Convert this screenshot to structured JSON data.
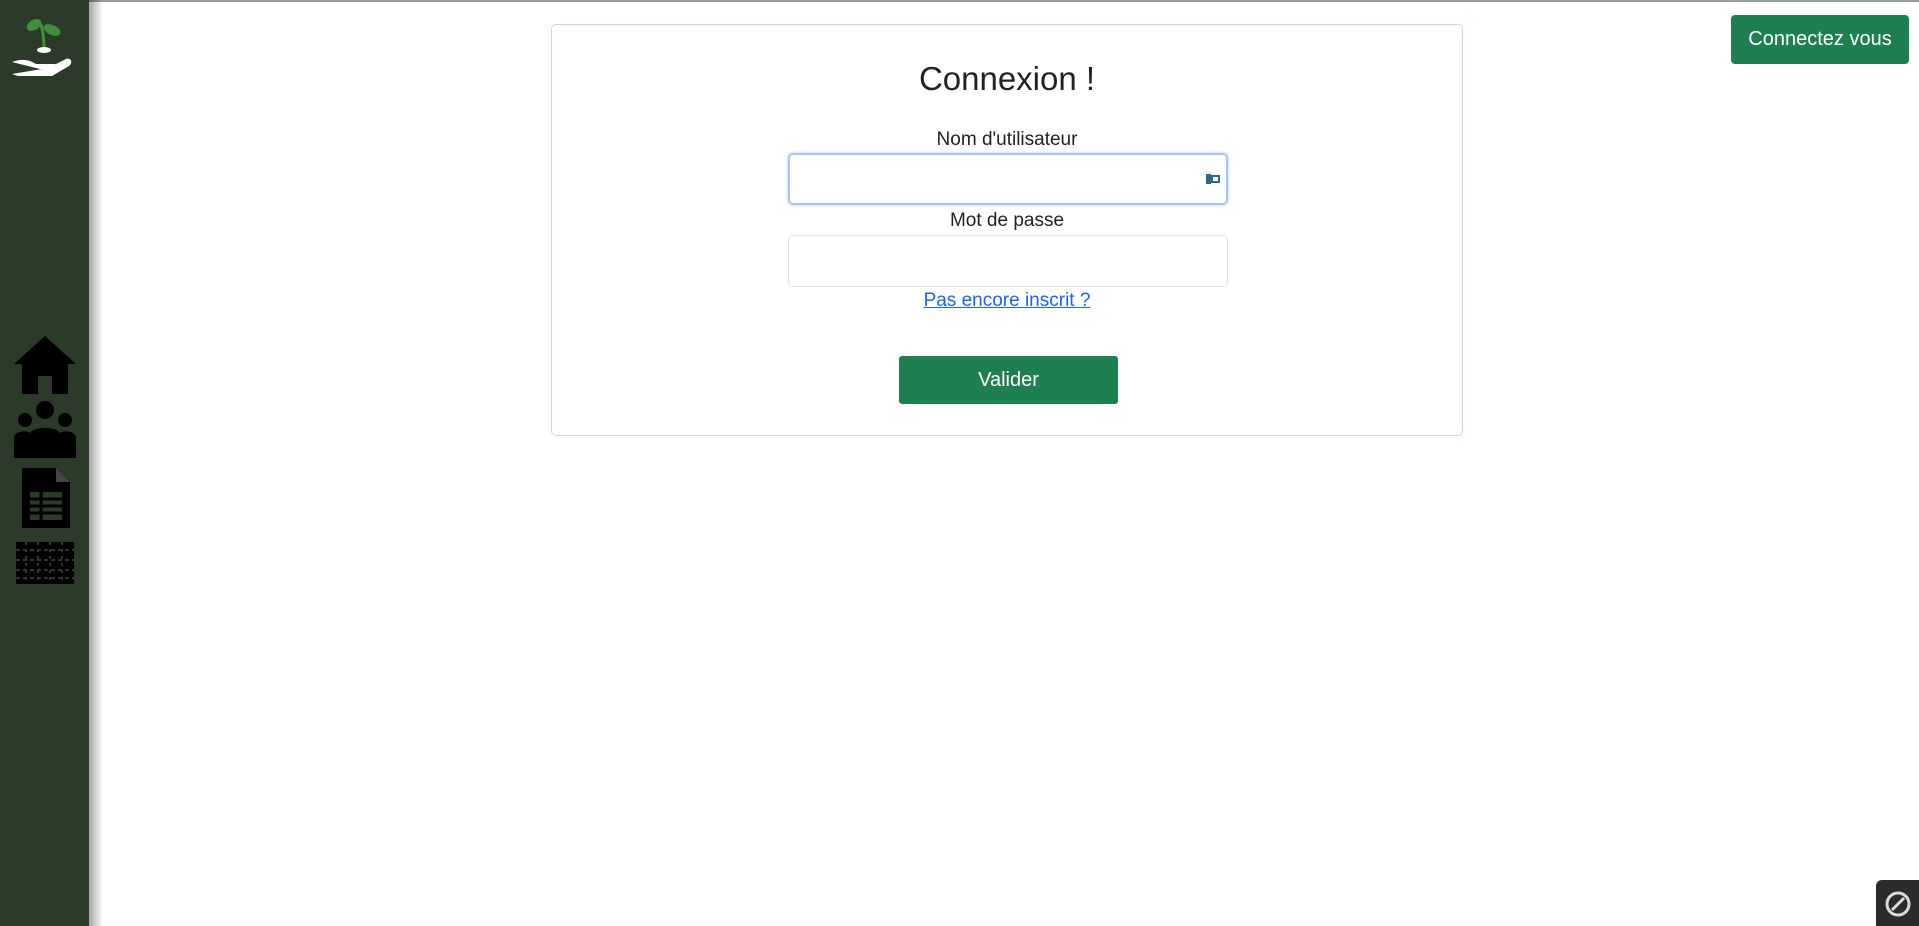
{
  "header": {
    "connect_label": "Connectez vous"
  },
  "sidebar": {
    "logo_icon": "seedling-hand-icon",
    "items": [
      {
        "icon": "home-icon"
      },
      {
        "icon": "users-group-icon"
      },
      {
        "icon": "spreadsheet-document-icon"
      },
      {
        "icon": "grid-field-icon"
      }
    ]
  },
  "login": {
    "title": "Connexion !",
    "username_label": "Nom d'utilisateur",
    "username_value": "",
    "password_label": "Mot de passe",
    "password_value": "",
    "register_link": "Pas encore inscrit ?",
    "submit_label": "Valider"
  },
  "colors": {
    "sidebar_bg": "#2c3a29",
    "accent_green": "#1e8050",
    "link_blue": "#1a62ff",
    "card_border": "#bfe0cd"
  }
}
